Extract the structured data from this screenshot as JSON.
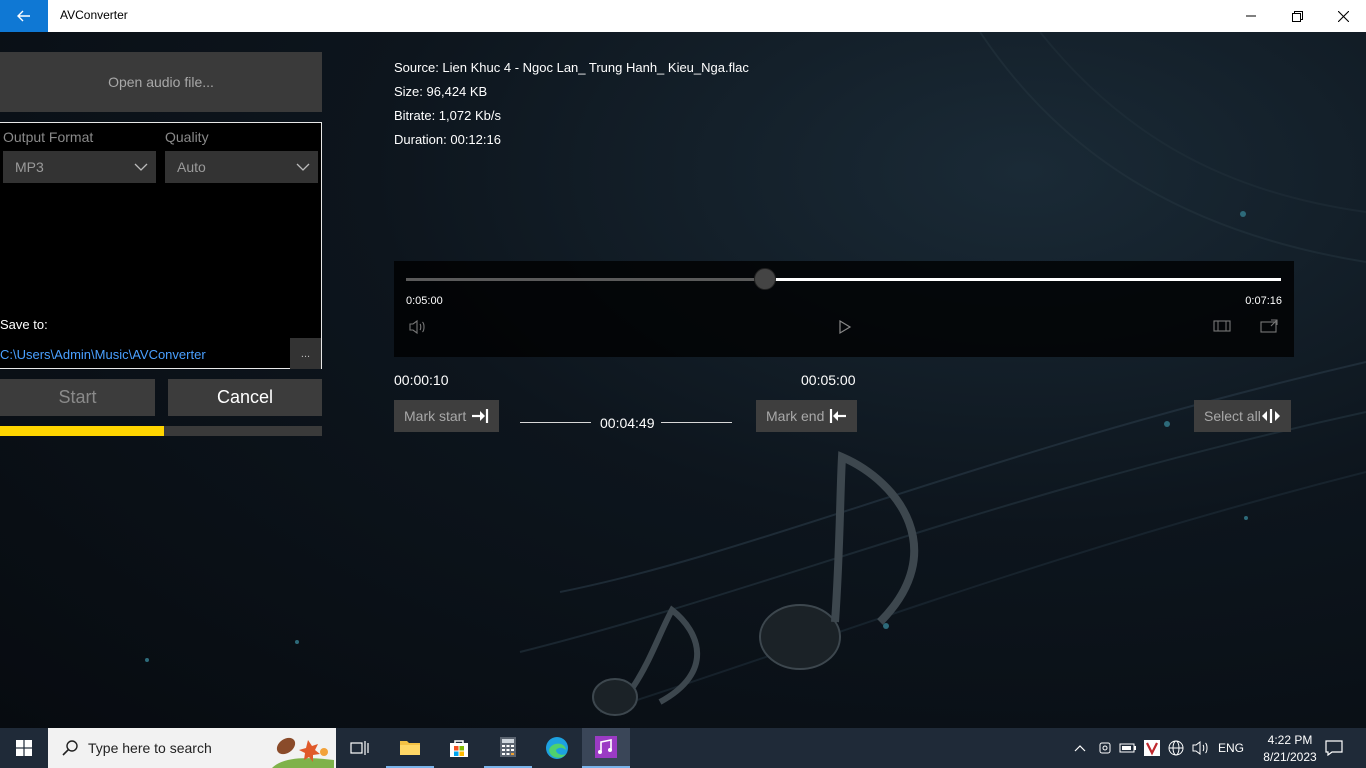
{
  "window": {
    "title": "AVConverter"
  },
  "left": {
    "open_label": "Open audio file...",
    "output_format_label": "Output Format",
    "output_format_value": "MP3",
    "quality_label": "Quality",
    "quality_value": "Auto",
    "save_to_label": "Save to:",
    "save_path": "C:\\Users\\Admin\\Music\\AVConverter",
    "browse_label": "...",
    "start_label": "Start",
    "cancel_label": "Cancel",
    "progress_fraction": 0.51
  },
  "info": {
    "source": "Source: Lien Khuc 4 - Ngoc Lan_ Trung Hanh_ Kieu_Nga.flac",
    "size": "Size: 96,424 KB",
    "bitrate": "Bitrate: 1,072 Kb/s",
    "duration": "Duration: 00:12:16"
  },
  "player": {
    "position_label": "0:05:00",
    "remaining_label": "0:07:16",
    "position_fraction": 0.41
  },
  "marks": {
    "start_time": "00:00:10",
    "end_time": "00:05:00",
    "mark_start_label": "Mark start",
    "mark_end_label": "Mark end",
    "selection_duration": "00:04:49",
    "select_all_label": "Select all"
  },
  "taskbar": {
    "search_placeholder": "Type here to search",
    "language": "ENG",
    "time": "4:22 PM",
    "date": "8/21/2023"
  }
}
